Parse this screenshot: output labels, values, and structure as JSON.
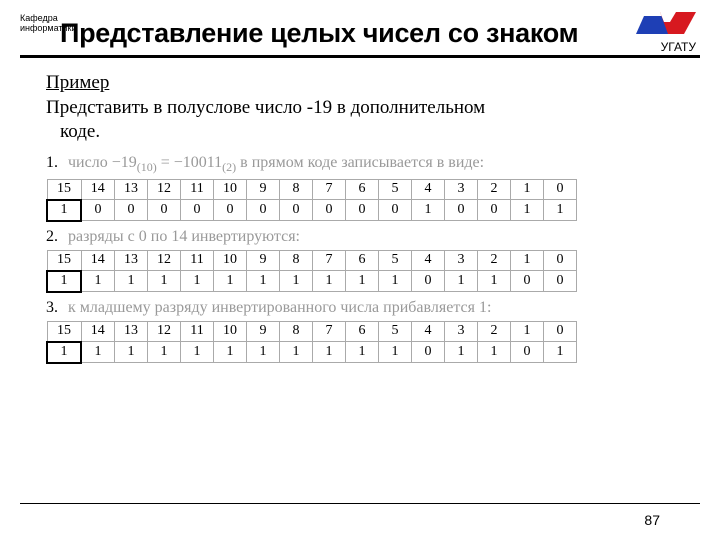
{
  "header": {
    "dept_line1": "Кафедра",
    "dept_line2": "информатики",
    "title": "Представление целых чисел со знаком",
    "org": "УГАТУ"
  },
  "example": {
    "heading": "Пример",
    "task_l1": "Представить в полуслове число -19 в дополнительном",
    "task_l2": "коде."
  },
  "steps": [
    {
      "n": "1.",
      "text_a": "число −19",
      "text_sub1": "(10)",
      "text_b": " = −10011",
      "text_sub2": "(2)",
      "text_c": "  в прямом коде записывается в виде:",
      "header": [
        "15",
        "14",
        "13",
        "12",
        "11",
        "10",
        "9",
        "8",
        "7",
        "6",
        "5",
        "4",
        "3",
        "2",
        "1",
        "0"
      ],
      "values": [
        "1",
        "0",
        "0",
        "0",
        "0",
        "0",
        "0",
        "0",
        "0",
        "0",
        "0",
        "1",
        "0",
        "0",
        "1",
        "1"
      ]
    },
    {
      "n": "2.",
      "text_a": "разряды с 0 по 14 инвертируются:",
      "header": [
        "15",
        "14",
        "13",
        "12",
        "11",
        "10",
        "9",
        "8",
        "7",
        "6",
        "5",
        "4",
        "3",
        "2",
        "1",
        "0"
      ],
      "values": [
        "1",
        "1",
        "1",
        "1",
        "1",
        "1",
        "1",
        "1",
        "1",
        "1",
        "1",
        "0",
        "1",
        "1",
        "0",
        "0"
      ]
    },
    {
      "n": "3.",
      "text_a": "к младшему разряду инвертированного числа прибавляется 1:",
      "header": [
        "15",
        "14",
        "13",
        "12",
        "11",
        "10",
        "9",
        "8",
        "7",
        "6",
        "5",
        "4",
        "3",
        "2",
        "1",
        "0"
      ],
      "values": [
        "1",
        "1",
        "1",
        "1",
        "1",
        "1",
        "1",
        "1",
        "1",
        "1",
        "1",
        "0",
        "1",
        "1",
        "0",
        "1"
      ]
    }
  ],
  "page": "87"
}
